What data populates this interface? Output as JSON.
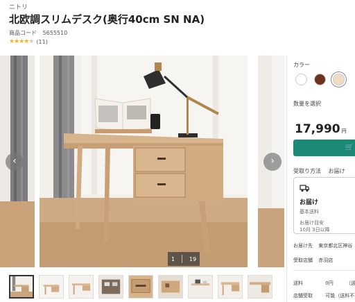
{
  "product": {
    "brand": "ニトリ",
    "title": "北欧調スリムデスク(奥行40cm SN NA)",
    "code_label": "商品コード",
    "code_value": "5655510",
    "rating": 4,
    "rating_max": 5,
    "review_count": "(11)"
  },
  "carousel": {
    "prev_icon": "chevron-left-icon",
    "next_icon": "chevron-right-icon",
    "prev_glyph": "‹",
    "next_glyph": "›",
    "current": "1",
    "total": "19"
  },
  "thumbnails_count": 11,
  "panel": {
    "color_label": "カラー",
    "swatches": [
      {
        "name": "white",
        "color": "#ffffff"
      },
      {
        "name": "brown",
        "color": "#6b3320"
      },
      {
        "name": "natural",
        "color": "#f0dcc4",
        "selected": true
      }
    ],
    "qty_label": "数量を選択",
    "price": "17,990",
    "price_unit": "円",
    "cart_icon": "cart-icon",
    "cart_glyph": "🛒",
    "receive_label": "受取り方法",
    "receive_value": "お届け",
    "delivery": {
      "title": "お届け",
      "fee": "基本送料",
      "eta_label": "お届け目安",
      "eta_value": "10月 3日以降"
    },
    "address_label": "お届け先",
    "address_value": "東京都北区神谷",
    "store_label": "受取店舗",
    "store_value": "赤羽店",
    "shipping_label": "送料",
    "shipping_value": "0円",
    "shipping_note": "（送料不",
    "pickup_label": "店舗受取",
    "pickup_value": "可能（送料不"
  },
  "colors": {
    "accent": "#1a8a77",
    "star": "#f2b01e"
  }
}
